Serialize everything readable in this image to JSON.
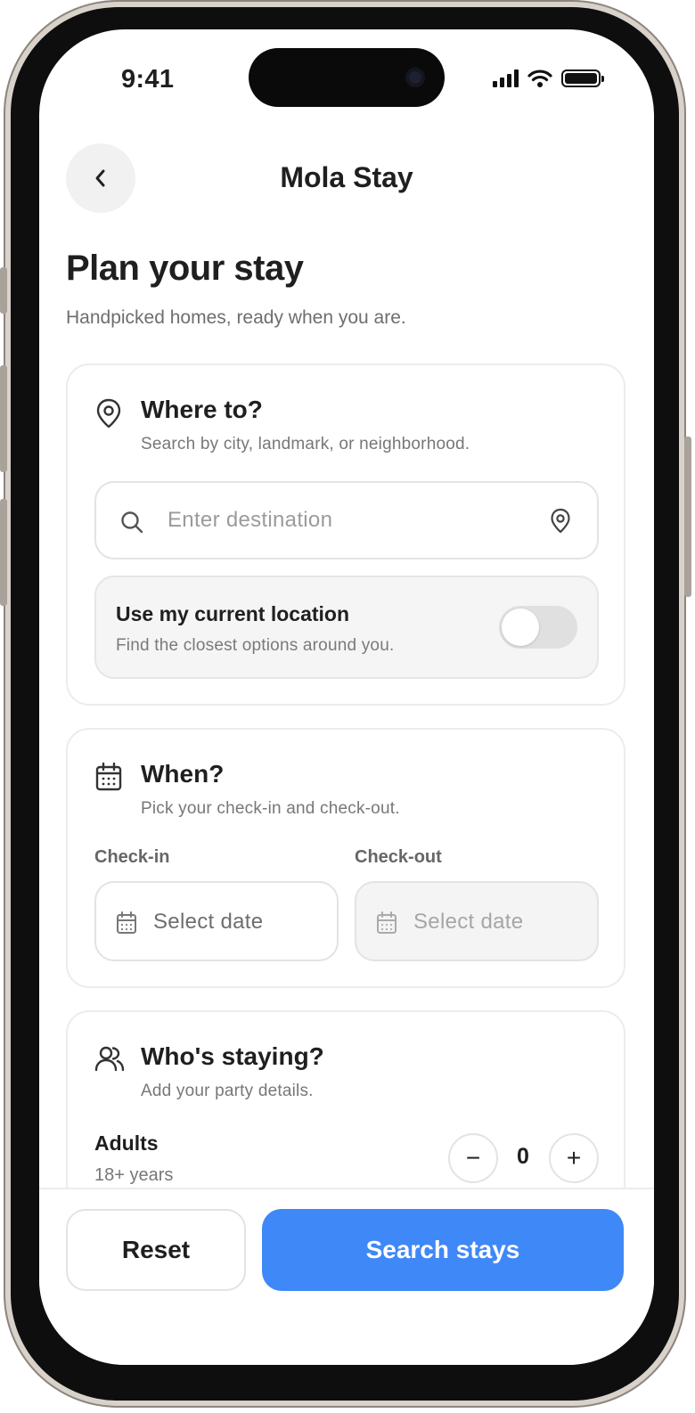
{
  "status_bar": {
    "time": "9:41"
  },
  "header": {
    "title": "Mola Stay"
  },
  "page": {
    "title": "Plan your stay",
    "subtitle": "Handpicked homes, ready when you are."
  },
  "where": {
    "title": "Where to?",
    "subtitle": "Search by city, landmark, or neighborhood.",
    "search_placeholder": "Enter destination",
    "search_value": "",
    "current_location": {
      "title": "Use my current location",
      "subtitle": "Find the closest options around you.",
      "enabled": false
    }
  },
  "when": {
    "title": "When?",
    "subtitle": "Pick your check-in and check-out.",
    "checkin_label": "Check-in",
    "checkin_value": "Select date",
    "checkout_label": "Check-out",
    "checkout_value": "Select date"
  },
  "who": {
    "title": "Who's staying?",
    "subtitle": "Add your party details.",
    "adults_label": "Adults",
    "adults_sub": "18+ years",
    "adults_count": "0",
    "decrement": "−",
    "increment": "+"
  },
  "actions": {
    "reset_label": "Reset",
    "search_label": "Search stays"
  },
  "colors": {
    "accent": "#3f88f7",
    "card_border": "#ececec",
    "muted_text": "#777777"
  }
}
